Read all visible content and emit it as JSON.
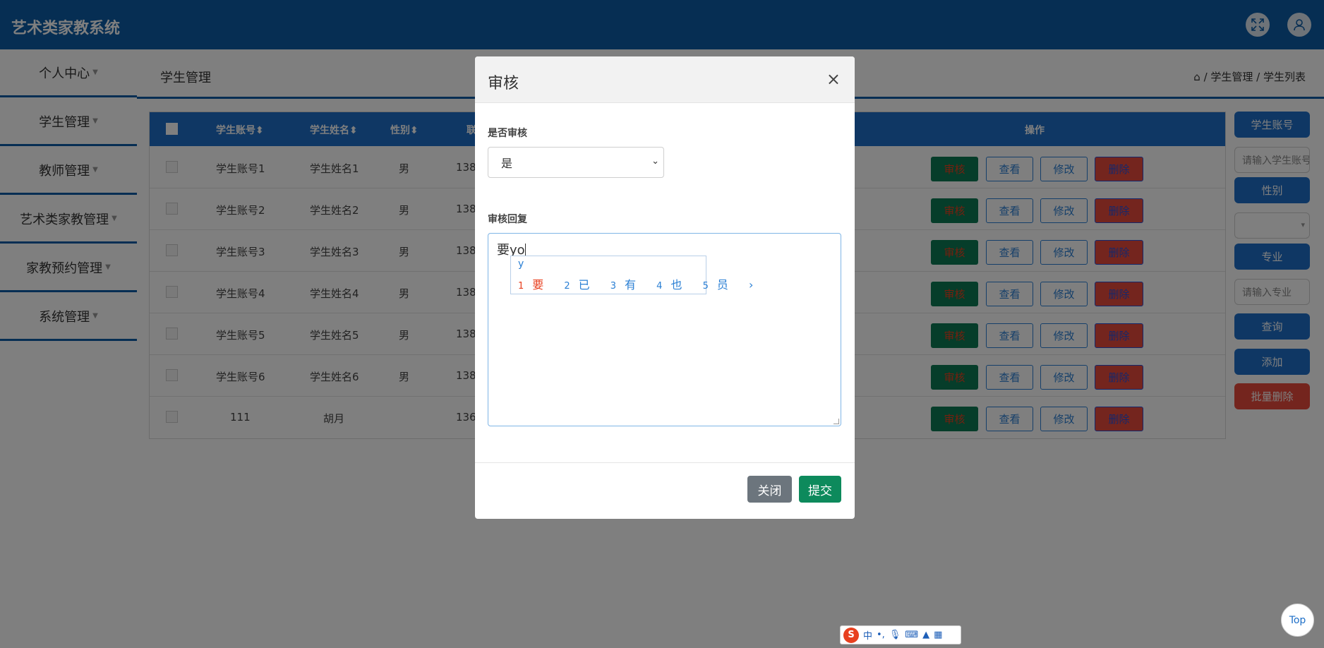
{
  "app": {
    "title": "艺术类家教系统"
  },
  "header": {
    "fullscreen_icon": "expand-icon",
    "avatar_icon": "user-icon"
  },
  "sidebar": {
    "items": [
      {
        "label": "个人中心"
      },
      {
        "label": "学生管理"
      },
      {
        "label": "教师管理"
      },
      {
        "label": "艺术类家教管理"
      },
      {
        "label": "家教预约管理"
      },
      {
        "label": "系统管理"
      }
    ]
  },
  "page": {
    "title": "学生管理",
    "breadcrumb": {
      "home_icon": "home-icon",
      "text": "/ 学生管理 / 学生列表"
    }
  },
  "table": {
    "columns": {
      "account": "学生账号",
      "name": "学生姓名",
      "gender": "性别",
      "phone": "联",
      "actions": "操作"
    },
    "sort_icon": "sort-icon",
    "rows": [
      {
        "account": "学生账号1",
        "name": "学生姓名1",
        "gender": "男",
        "phone": "138"
      },
      {
        "account": "学生账号2",
        "name": "学生姓名2",
        "gender": "男",
        "phone": "138"
      },
      {
        "account": "学生账号3",
        "name": "学生姓名3",
        "gender": "男",
        "phone": "138"
      },
      {
        "account": "学生账号4",
        "name": "学生姓名4",
        "gender": "男",
        "phone": "138"
      },
      {
        "account": "学生账号5",
        "name": "学生姓名5",
        "gender": "男",
        "phone": "138"
      },
      {
        "account": "学生账号6",
        "name": "学生姓名6",
        "gender": "男",
        "phone": "138"
      },
      {
        "account": "111",
        "name": "胡月",
        "gender": "",
        "phone": "136"
      }
    ],
    "row_buttons": {
      "audit": "审核",
      "view": "查看",
      "edit": "修改",
      "delete": "删除"
    }
  },
  "filter": {
    "account_label": "学生账号",
    "account_placeholder": "请输入学生账号",
    "gender_label": "性别",
    "gender_value": "",
    "major_label": "专业",
    "major_placeholder": "请输入专业",
    "search": "查询",
    "add": "添加",
    "batch_delete": "批量删除"
  },
  "modal": {
    "title": "审核",
    "close": "×",
    "audit_label": "是否审核",
    "audit_value": "是",
    "reply_label": "审核回复",
    "reply_value": "要yo",
    "close_button": "关闭",
    "submit_button": "提交"
  },
  "ime": {
    "pinyin": "y",
    "candidates": [
      {
        "num": "1",
        "char": "要"
      },
      {
        "num": "2",
        "char": "已"
      },
      {
        "num": "3",
        "char": "有"
      },
      {
        "num": "4",
        "char": "也"
      },
      {
        "num": "5",
        "char": "员"
      }
    ],
    "next": "›",
    "status": {
      "logo": "S",
      "mode": "中"
    }
  },
  "back_to_top": "Top",
  "colors": {
    "primary": "#0d5ca6",
    "header": "#1e6fc8",
    "danger": "#e84a3c",
    "success": "#0d8a5c"
  }
}
